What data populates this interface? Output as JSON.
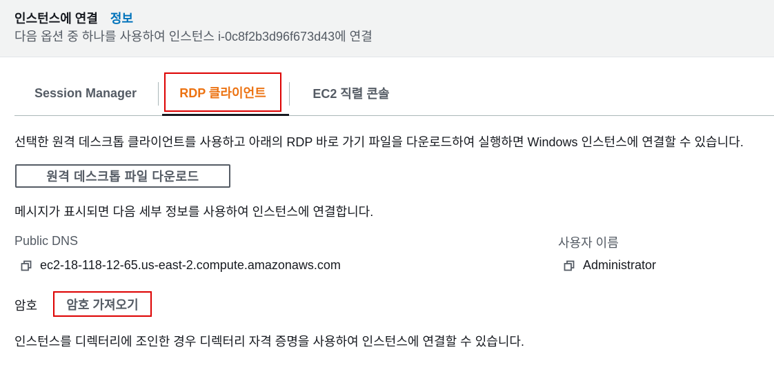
{
  "header": {
    "title": "인스턴스에 연결",
    "info_link": "정보",
    "subtitle": "다음 옵션 중 하나를 사용하여 인스턴스 i-0c8f2b3d96f673d43에 연결"
  },
  "tabs": [
    {
      "label": "Session Manager",
      "selected": false
    },
    {
      "label": "RDP 클라이언트",
      "selected": true
    },
    {
      "label": "EC2 직렬 콘솔",
      "selected": false
    }
  ],
  "rdp": {
    "description": "선택한 원격 데스크톱 클라이언트를 사용하고 아래의 RDP 바로 가기 파일을 다운로드하여 실행하면 Windows 인스턴스에 연결할 수 있습니다.",
    "download_button": "원격 데스크톱 파일 다운로드",
    "prompt_text": "메시지가 표시되면 다음 세부 정보를 사용하여 인스턴스에 연결합니다.",
    "public_dns_label": "Public DNS",
    "public_dns_value": "ec2-18-118-12-65.us-east-2.compute.amazonaws.com",
    "username_label": "사용자 이름",
    "username_value": "Administrator",
    "password_label": "암호",
    "get_password_button": "암호 가져오기",
    "footer_note": "인스턴스를 디렉터리에 조인한 경우 디렉터리 자격 증명을 사용하여 인스턴스에 연결할 수 있습니다."
  },
  "colors": {
    "accent_orange": "#ec7211",
    "link_blue": "#0073bb",
    "highlight_red": "#dd0000"
  },
  "icons": {
    "copy": "copy-icon"
  }
}
